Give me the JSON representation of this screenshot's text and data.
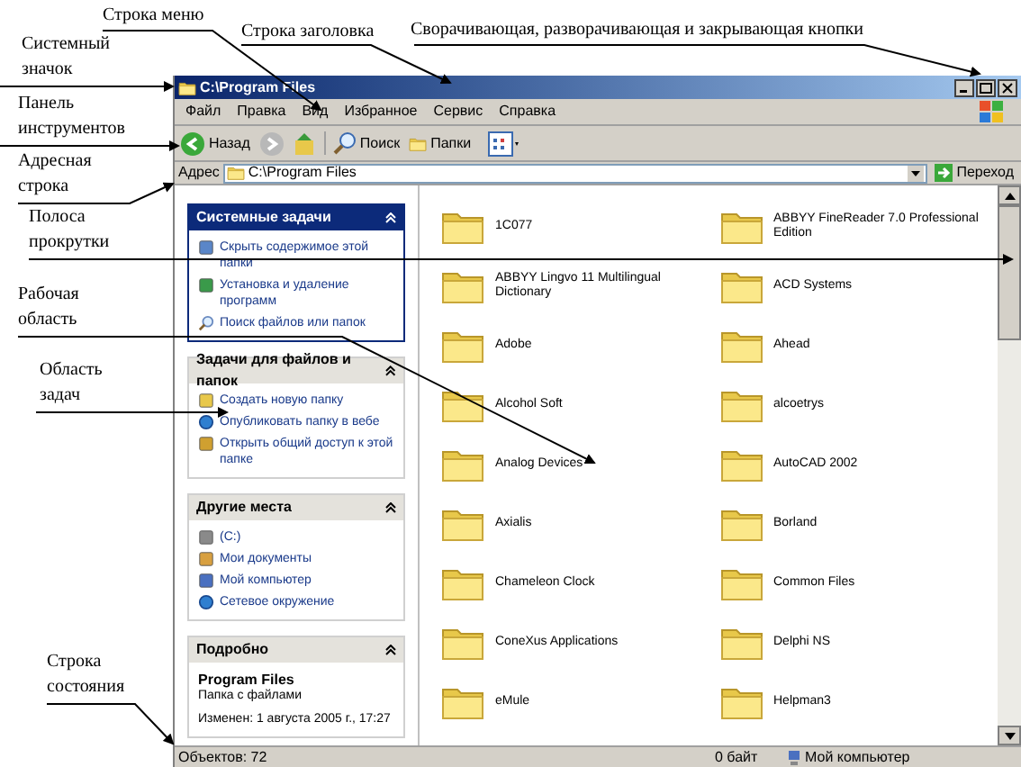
{
  "annotations": [
    {
      "lines": [
        "Строка меню"
      ]
    },
    {
      "lines": [
        "Строка заголовка"
      ]
    },
    {
      "lines": [
        "Сворачивающая, разворачивающая и закрывающая кнопки"
      ]
    },
    {
      "lines": [
        "Системный",
        "значок"
      ]
    },
    {
      "lines": [
        "Панель",
        "инструментов"
      ]
    },
    {
      "lines": [
        "Адресная",
        "строка"
      ]
    },
    {
      "lines": [
        "Полоса",
        "прокрутки"
      ]
    },
    {
      "lines": [
        "Рабочая",
        "область"
      ]
    },
    {
      "lines": [
        "Область",
        "задач"
      ]
    },
    {
      "lines": [
        "Строка",
        "состояния"
      ]
    }
  ],
  "window": {
    "title": "C:\\Program Files"
  },
  "menu": [
    "Файл",
    "Правка",
    "Вид",
    "Избранное",
    "Сервис",
    "Справка"
  ],
  "toolbar": {
    "back": "Назад",
    "search": "Поиск",
    "folders": "Папки"
  },
  "address": {
    "label": "Адрес",
    "value": "C:\\Program Files",
    "go": "Переход"
  },
  "task_pane": [
    {
      "title": "Системные задачи",
      "kind": "special",
      "items": [
        "Скрыть содержимое этой папки",
        "Установка и удаление программ",
        "Поиск файлов или папок"
      ]
    },
    {
      "title": "Задачи для файлов и папок",
      "kind": "normal",
      "items": [
        "Создать новую папку",
        "Опубликовать папку в вебе",
        "Открыть общий доступ к этой папке"
      ]
    },
    {
      "title": "Другие места",
      "kind": "normal",
      "items": [
        "(C:)",
        "Мои документы",
        "Мой компьютер",
        "Сетевое окружение"
      ]
    },
    {
      "title": "Подробно",
      "kind": "details",
      "details": {
        "name": "Program Files",
        "type": "Папка с файлами",
        "modified": "Изменен: 1 августа 2005 г., 17:27"
      }
    }
  ],
  "folder_rows": [
    [
      "1C077",
      "ABBYY FineReader 7.0 Professional Edition"
    ],
    [
      "ABBYY Lingvo 11 Multilingual Dictionary",
      "ACD Systems"
    ],
    [
      "Adobe",
      "Ahead"
    ],
    [
      "Alcohol Soft",
      "alcoetrys"
    ],
    [
      "Analog Devices",
      "AutoCAD 2002"
    ],
    [
      "Axialis",
      "Borland"
    ],
    [
      "Chameleon Clock",
      "Common Files"
    ],
    [
      "ConeXus Applications",
      "Delphi NS"
    ],
    [
      "eMule",
      "Helpman3"
    ]
  ],
  "status_bar": {
    "objects": "Объектов: 72",
    "size": "0 байт",
    "location": "Мой компьютер"
  }
}
